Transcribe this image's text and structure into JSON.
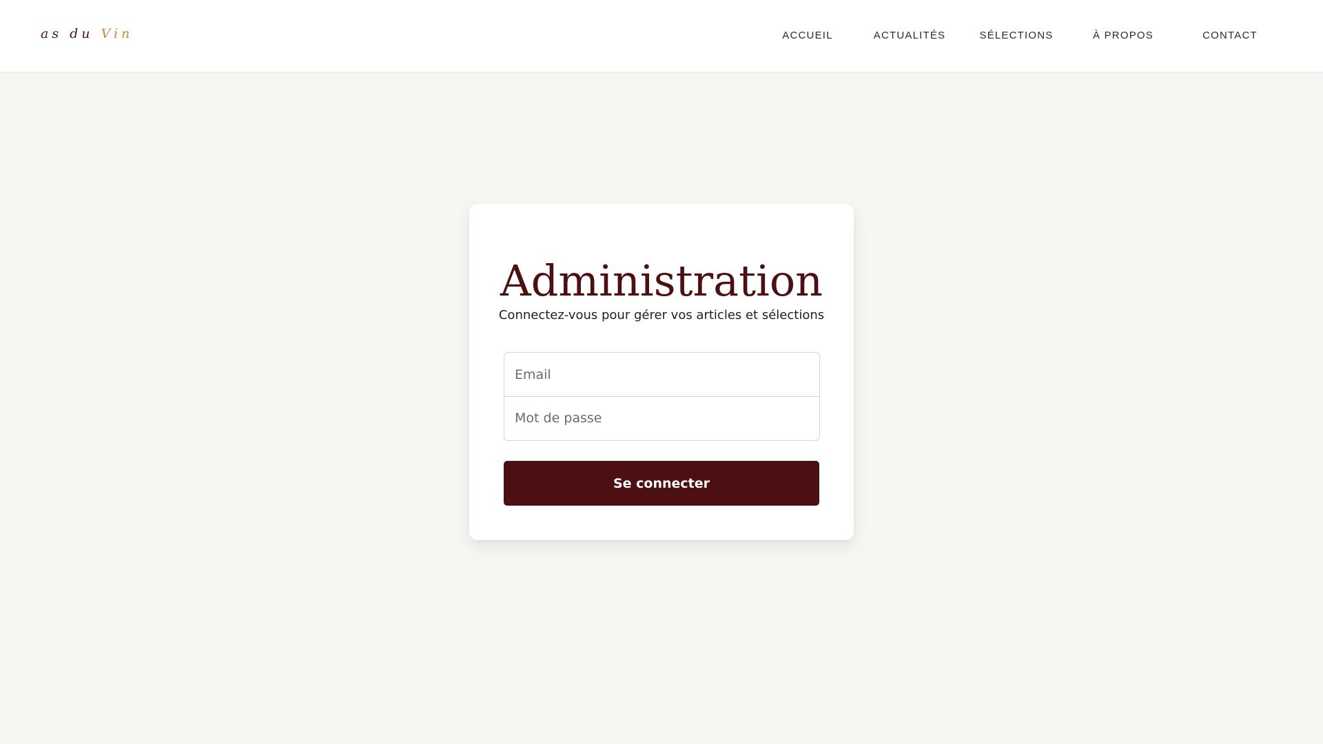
{
  "header": {
    "brand": {
      "part1": "as du",
      "part2": "Vin"
    },
    "nav": [
      {
        "label": "ACCUEIL"
      },
      {
        "label": "ACTUALITÉS"
      },
      {
        "label": "SÉLECTIONS"
      },
      {
        "label": "À PROPOS"
      },
      {
        "label": "CONTACT"
      }
    ]
  },
  "login": {
    "title": "Administration",
    "subtitle": "Connectez-vous pour gérer vos articles et sélections",
    "email_placeholder": "Email",
    "email_value": "",
    "password_placeholder": "Mot de passe",
    "password_value": "",
    "submit_label": "Se connecter"
  },
  "colors": {
    "brand_primary": "#4d1012",
    "brand_accent": "#c88a3b",
    "background": "#f7f6f2",
    "surface": "#ffffff"
  }
}
